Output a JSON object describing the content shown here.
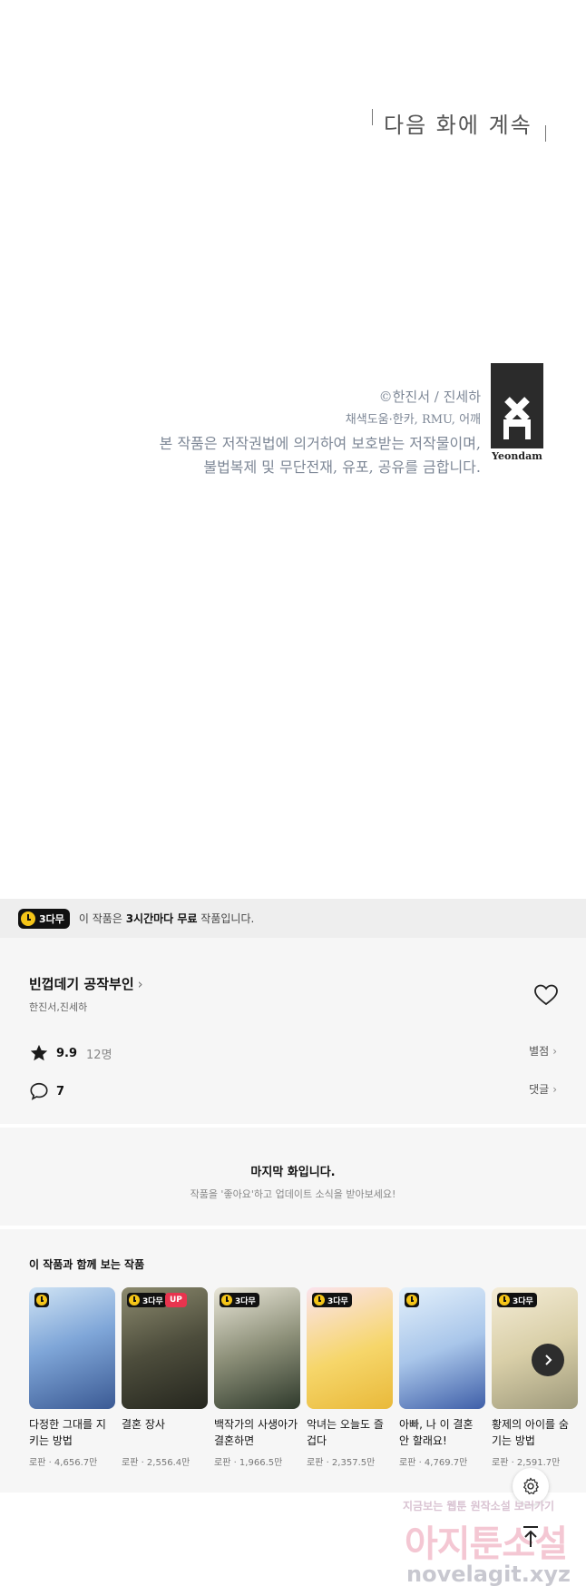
{
  "comic": {
    "next_episode": "다음 화에 계속",
    "copyright_lines": [
      "©한진서 / 진세하",
      "채색도움·한카, RMU, 어깨",
      "본 작품은 저작권법에 의거하여 보호받는 저작물이며,",
      "불법복제 및 무단전재, 유포, 공유를 금합니다."
    ],
    "publisher_logo": "Yeondam"
  },
  "banner": {
    "badge": "3다무",
    "text_pre": "이 작품은 ",
    "text_bold": "3시간마다 무료",
    "text_post": " 작품입니다."
  },
  "series": {
    "title": "빈껍데기 공작부인",
    "author": "한진서,진세하",
    "rating": "9.9",
    "rating_count": "12명",
    "rating_link": "별점",
    "comment_count": "7",
    "comment_link": "댓글",
    "chevron": "›"
  },
  "last_episode": {
    "heading": "마지막 화입니다.",
    "sub": "작품을 '좋아요'하고 업데이트 소식을 받아보세요!"
  },
  "recommendations": {
    "title": "이 작품과 함께 보는 작품",
    "items": [
      {
        "title": "다정한 그대를 지키는 방법",
        "meta": "로판 · 4,656.7만",
        "badge": "",
        "up": ""
      },
      {
        "title": "결혼 장사",
        "meta": "로판 · 2,556.4만",
        "badge": "3다무",
        "up": "UP"
      },
      {
        "title": "백작가의 사생아가 결혼하면",
        "meta": "로판 · 1,966.5만",
        "badge": "3다무",
        "up": ""
      },
      {
        "title": "악녀는 오늘도 즐겁다",
        "meta": "로판 · 2,357.5만",
        "badge": "3다무",
        "up": ""
      },
      {
        "title": "아빠, 나 이 결혼 안 할래요!",
        "meta": "로판 · 4,769.7만",
        "badge": "",
        "up": ""
      },
      {
        "title": "황제의 아이를 숨기는 방법",
        "meta": "로판 · 2,591.7만",
        "badge": "3다무",
        "up": ""
      }
    ]
  },
  "watermark": {
    "line1": "지금보는 웹툰 원작소설 보러가기",
    "line2": "아지툰소설",
    "line3": "novelagit.xyz"
  },
  "colors": {
    "banner_bg": "#eeeeee",
    "panel_bg": "#f6f6f6",
    "clock_yellow": "#f5c518",
    "up_red": "#e8344e"
  }
}
